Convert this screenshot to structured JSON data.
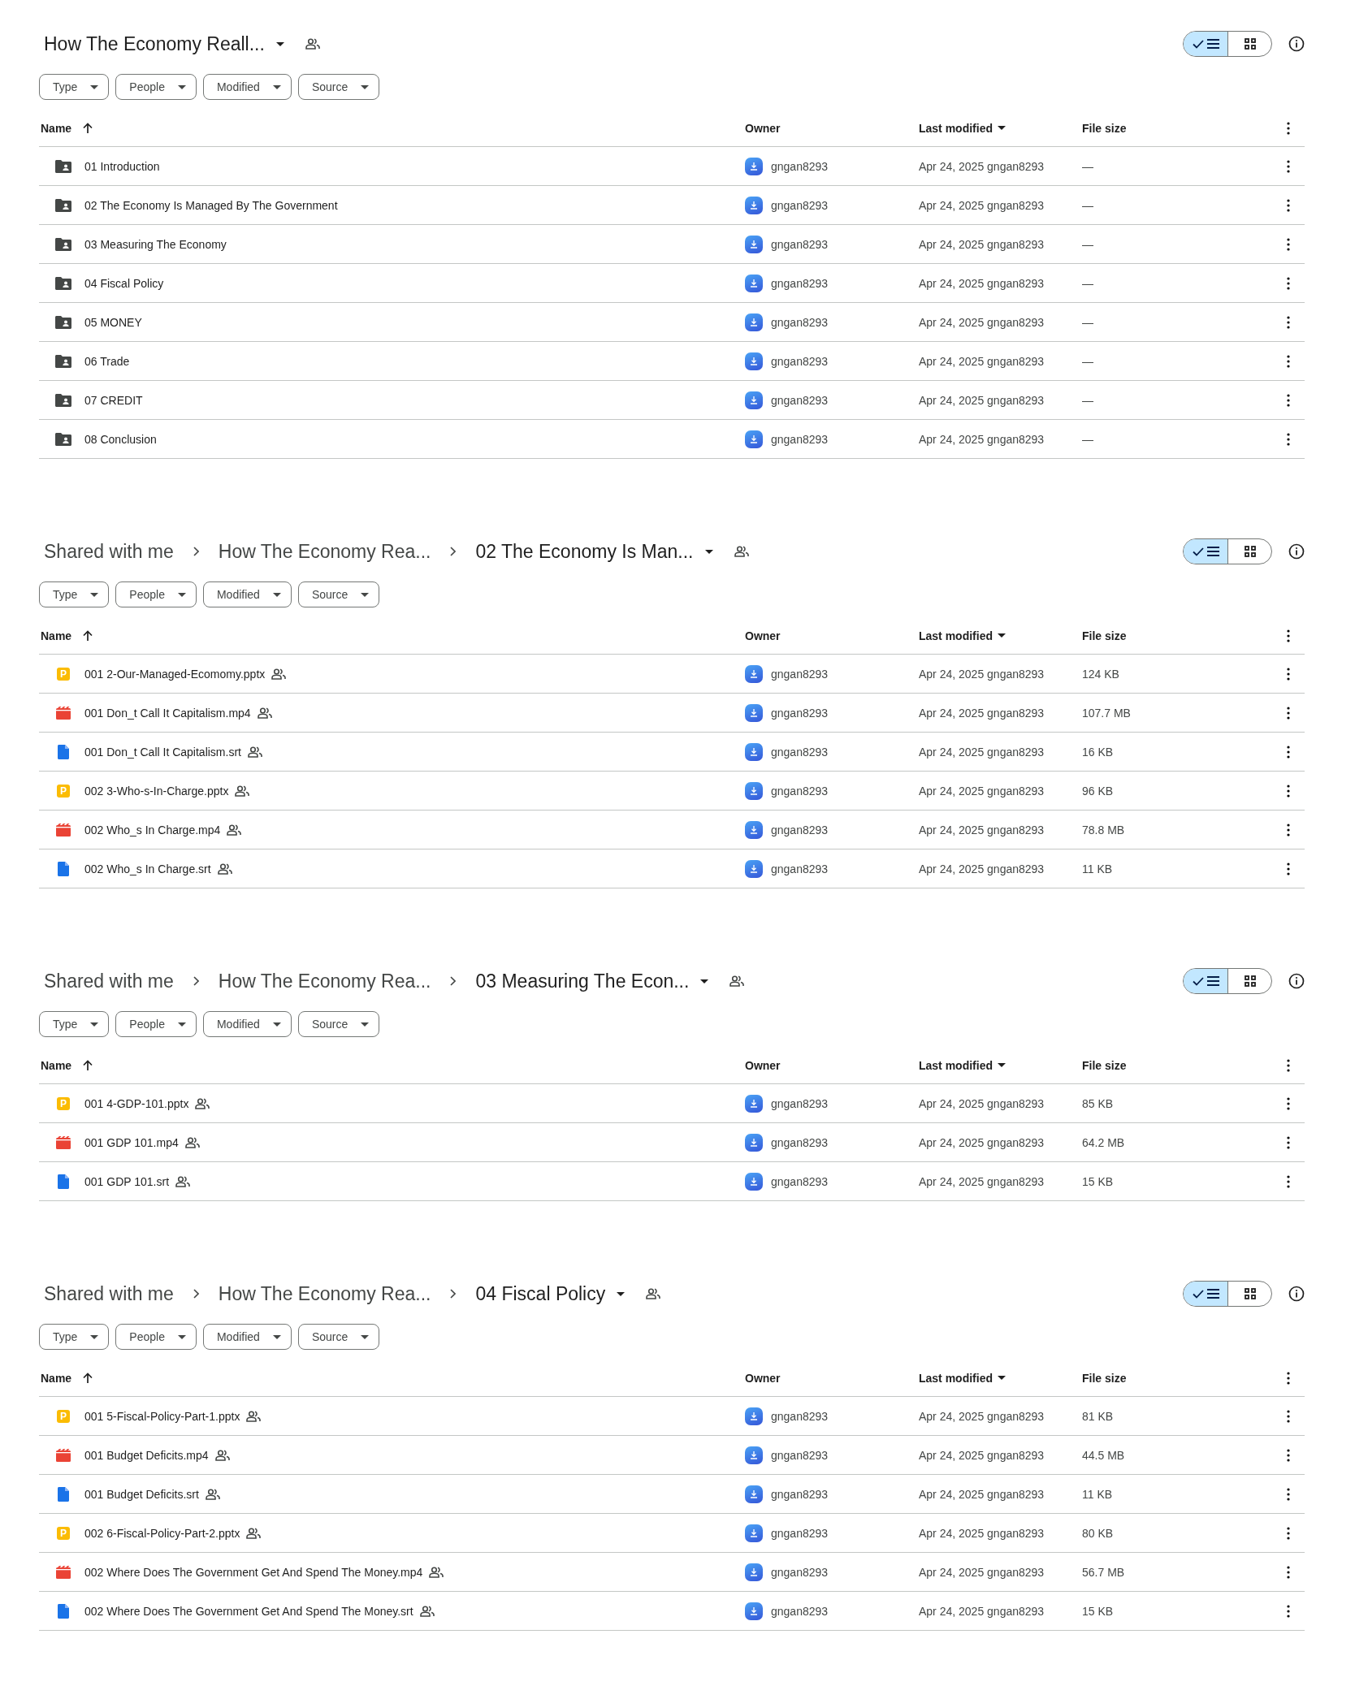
{
  "panels": [
    {
      "path": [
        "How The Economy Reall..."
      ],
      "view_options": [
        {
          "kind": "list",
          "selected": true
        },
        {
          "kind": "grid",
          "selected": false
        }
      ],
      "filters": [
        "Type",
        "People",
        "Modified",
        "Source"
      ],
      "columns": [
        {
          "label": "Name",
          "sorted_ascending": true,
          "sorted_descending": false
        },
        {
          "label": "Owner",
          "sorted_ascending": false,
          "sorted_descending": false
        },
        {
          "label": "Last modified",
          "sorted_ascending": false,
          "sorted_descending": true
        },
        {
          "label": "File size",
          "sorted_ascending": false,
          "sorted_descending": false
        }
      ],
      "rows": [
        {
          "kind": "folder",
          "name": "01 Introduction",
          "shared": false,
          "owner": "gngan8293",
          "modified": "Apr 24, 2025 gngan8293",
          "size": "—"
        },
        {
          "kind": "folder",
          "name": "02 The Economy Is Managed By The Government",
          "shared": false,
          "owner": "gngan8293",
          "modified": "Apr 24, 2025 gngan8293",
          "size": "—"
        },
        {
          "kind": "folder",
          "name": "03 Measuring The Economy",
          "shared": false,
          "owner": "gngan8293",
          "modified": "Apr 24, 2025 gngan8293",
          "size": "—"
        },
        {
          "kind": "folder",
          "name": "04 Fiscal Policy",
          "shared": false,
          "owner": "gngan8293",
          "modified": "Apr 24, 2025 gngan8293",
          "size": "—"
        },
        {
          "kind": "folder",
          "name": "05 MONEY",
          "shared": false,
          "owner": "gngan8293",
          "modified": "Apr 24, 2025 gngan8293",
          "size": "—"
        },
        {
          "kind": "folder",
          "name": "06 Trade",
          "shared": false,
          "owner": "gngan8293",
          "modified": "Apr 24, 2025 gngan8293",
          "size": "—"
        },
        {
          "kind": "folder",
          "name": "07 CREDIT",
          "shared": false,
          "owner": "gngan8293",
          "modified": "Apr 24, 2025 gngan8293",
          "size": "—"
        },
        {
          "kind": "folder",
          "name": "08 Conclusion",
          "shared": false,
          "owner": "gngan8293",
          "modified": "Apr 24, 2025 gngan8293",
          "size": "—"
        }
      ]
    },
    {
      "path": [
        "Shared with me",
        "How The Economy Rea...",
        "02 The Economy Is Man..."
      ],
      "view_options": [
        {
          "kind": "list",
          "selected": true
        },
        {
          "kind": "grid",
          "selected": false
        }
      ],
      "filters": [
        "Type",
        "People",
        "Modified",
        "Source"
      ],
      "columns": [
        {
          "label": "Name",
          "sorted_ascending": true,
          "sorted_descending": false
        },
        {
          "label": "Owner",
          "sorted_ascending": false,
          "sorted_descending": false
        },
        {
          "label": "Last modified",
          "sorted_ascending": false,
          "sorted_descending": true
        },
        {
          "label": "File size",
          "sorted_ascending": false,
          "sorted_descending": false
        }
      ],
      "rows": [
        {
          "kind": "slides",
          "icon_text": "P",
          "name": "001 2-Our-Managed-Ecomomy.pptx",
          "shared": true,
          "owner": "gngan8293",
          "modified": "Apr 24, 2025 gngan8293",
          "size": "124 KB"
        },
        {
          "kind": "video",
          "name": "001 Don_t Call It Capitalism.mp4",
          "shared": true,
          "owner": "gngan8293",
          "modified": "Apr 24, 2025 gngan8293",
          "size": "107.7 MB"
        },
        {
          "kind": "doc",
          "name": "001 Don_t Call It Capitalism.srt",
          "shared": true,
          "owner": "gngan8293",
          "modified": "Apr 24, 2025 gngan8293",
          "size": "16 KB"
        },
        {
          "kind": "slides",
          "icon_text": "P",
          "name": "002 3-Who-s-In-Charge.pptx",
          "shared": true,
          "owner": "gngan8293",
          "modified": "Apr 24, 2025 gngan8293",
          "size": "96 KB"
        },
        {
          "kind": "video",
          "name": "002 Who_s In Charge.mp4",
          "shared": true,
          "owner": "gngan8293",
          "modified": "Apr 24, 2025 gngan8293",
          "size": "78.8 MB"
        },
        {
          "kind": "doc",
          "name": "002 Who_s In Charge.srt",
          "shared": true,
          "owner": "gngan8293",
          "modified": "Apr 24, 2025 gngan8293",
          "size": "11 KB"
        }
      ]
    },
    {
      "path": [
        "Shared with me",
        "How The Economy Rea...",
        "03 Measuring The Econ..."
      ],
      "view_options": [
        {
          "kind": "list",
          "selected": true
        },
        {
          "kind": "grid",
          "selected": false
        }
      ],
      "filters": [
        "Type",
        "People",
        "Modified",
        "Source"
      ],
      "columns": [
        {
          "label": "Name",
          "sorted_ascending": true,
          "sorted_descending": false
        },
        {
          "label": "Owner",
          "sorted_ascending": false,
          "sorted_descending": false
        },
        {
          "label": "Last modified",
          "sorted_ascending": false,
          "sorted_descending": true
        },
        {
          "label": "File size",
          "sorted_ascending": false,
          "sorted_descending": false
        }
      ],
      "rows": [
        {
          "kind": "slides",
          "icon_text": "P",
          "name": "001 4-GDP-101.pptx",
          "shared": true,
          "owner": "gngan8293",
          "modified": "Apr 24, 2025 gngan8293",
          "size": "85 KB"
        },
        {
          "kind": "video",
          "name": "001 GDP 101.mp4",
          "shared": true,
          "owner": "gngan8293",
          "modified": "Apr 24, 2025 gngan8293",
          "size": "64.2 MB"
        },
        {
          "kind": "doc",
          "name": "001 GDP 101.srt",
          "shared": true,
          "owner": "gngan8293",
          "modified": "Apr 24, 2025 gngan8293",
          "size": "15 KB"
        }
      ]
    },
    {
      "path": [
        "Shared with me",
        "How The Economy Rea...",
        "04 Fiscal Policy"
      ],
      "view_options": [
        {
          "kind": "list",
          "selected": true
        },
        {
          "kind": "grid",
          "selected": false
        }
      ],
      "filters": [
        "Type",
        "People",
        "Modified",
        "Source"
      ],
      "columns": [
        {
          "label": "Name",
          "sorted_ascending": true,
          "sorted_descending": false
        },
        {
          "label": "Owner",
          "sorted_ascending": false,
          "sorted_descending": false
        },
        {
          "label": "Last modified",
          "sorted_ascending": false,
          "sorted_descending": true
        },
        {
          "label": "File size",
          "sorted_ascending": false,
          "sorted_descending": false
        }
      ],
      "rows": [
        {
          "kind": "slides",
          "icon_text": "P",
          "name": "001 5-Fiscal-Policy-Part-1.pptx",
          "shared": true,
          "owner": "gngan8293",
          "modified": "Apr 24, 2025 gngan8293",
          "size": "81 KB"
        },
        {
          "kind": "video",
          "name": "001 Budget Deficits.mp4",
          "shared": true,
          "owner": "gngan8293",
          "modified": "Apr 24, 2025 gngan8293",
          "size": "44.5 MB"
        },
        {
          "kind": "doc",
          "name": "001 Budget Deficits.srt",
          "shared": true,
          "owner": "gngan8293",
          "modified": "Apr 24, 2025 gngan8293",
          "size": "11 KB"
        },
        {
          "kind": "slides",
          "icon_text": "P",
          "name": "002 6-Fiscal-Policy-Part-2.pptx",
          "shared": true,
          "owner": "gngan8293",
          "modified": "Apr 24, 2025 gngan8293",
          "size": "80 KB"
        },
        {
          "kind": "video",
          "name": "002 Where Does The Government Get And Spend The Money.mp4",
          "shared": true,
          "owner": "gngan8293",
          "modified": "Apr 24, 2025 gngan8293",
          "size": "56.7 MB"
        },
        {
          "kind": "doc",
          "name": "002 Where Does The Government Get And Spend The Money.srt",
          "shared": true,
          "owner": "gngan8293",
          "modified": "Apr 24, 2025 gngan8293",
          "size": "15 KB"
        }
      ]
    }
  ]
}
